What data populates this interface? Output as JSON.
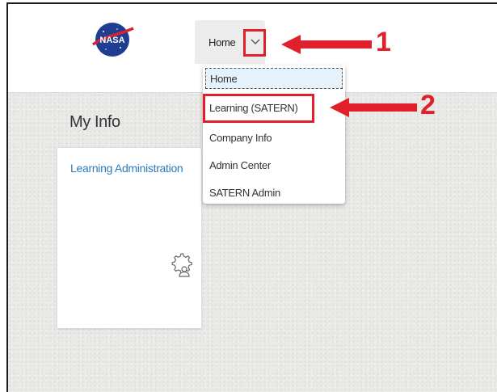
{
  "logo": {
    "text": "NASA"
  },
  "nav": {
    "home_label": "Home",
    "chevron_icon": "chevron-down-icon"
  },
  "menu": {
    "items": [
      {
        "label": "Home",
        "selected": true
      },
      {
        "label": "Learning (SATERN)",
        "highlighted": true
      },
      {
        "label": "Company Info"
      },
      {
        "label": "Admin Center"
      },
      {
        "label": "SATERN Admin"
      }
    ]
  },
  "page": {
    "section_title": "My Info"
  },
  "tile": {
    "title": "Learning Administration",
    "icon": "settings-user-icon"
  },
  "annotations": {
    "step1": "1",
    "step2": "2",
    "color": "#e0202a"
  }
}
